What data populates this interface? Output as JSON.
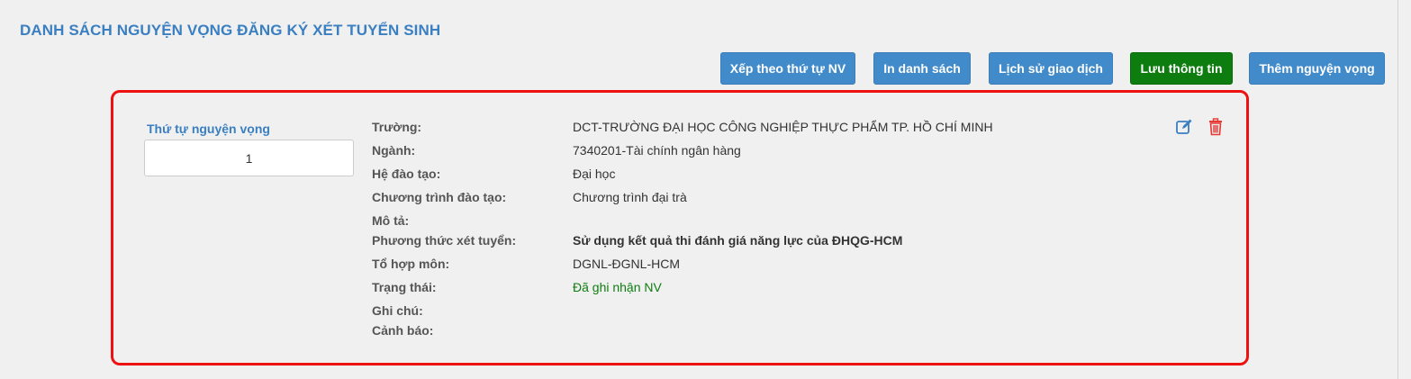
{
  "page": {
    "title": "DANH SÁCH NGUYỆN VỌNG ĐĂNG KÝ XÉT TUYỂN SINH"
  },
  "toolbar": {
    "sort_label": "Xếp theo thứ tự NV",
    "print_label": "In danh sách",
    "history_label": "Lịch sử giao dịch",
    "save_label": "Lưu thông tin",
    "add_label": "Thêm nguyện vọng"
  },
  "wish": {
    "order_label": "Thứ tự nguyện vọng",
    "order_value": "1",
    "fields": [
      {
        "label": "Trường:",
        "value": "DCT-TRƯỜNG ĐẠI HỌC CÔNG NGHIỆP THỰC PHẨM TP. HỒ CHÍ MINH"
      },
      {
        "label": "Ngành:",
        "value": "7340201-Tài chính ngân hàng"
      },
      {
        "label": "Hệ đào tạo:",
        "value": "Đại học"
      },
      {
        "label": "Chương trình đào tạo:",
        "value": "Chương trình đại trà"
      },
      {
        "label": "Mô tả:",
        "value": ""
      },
      {
        "label": "Phương thức xét tuyển:",
        "value": "Sử dụng kết quả thi đánh giá năng lực của ĐHQG-HCM"
      },
      {
        "label": "Tổ hợp môn:",
        "value": "DGNL-ĐGNL-HCM"
      },
      {
        "label": "Trạng thái:",
        "value": "Đã ghi nhận NV"
      },
      {
        "label": "Ghi chú:",
        "value": ""
      },
      {
        "label": "Cảnh báo:",
        "value": ""
      }
    ]
  },
  "icons": {
    "edit": "edit-icon",
    "delete": "trash-icon"
  },
  "colors": {
    "title": "#3a7fc1",
    "button_blue": "#428bca",
    "button_green": "#0e7d10",
    "highlight_border": "#ee1111",
    "status_green": "#0e7d10",
    "delete_red": "#e53935"
  }
}
